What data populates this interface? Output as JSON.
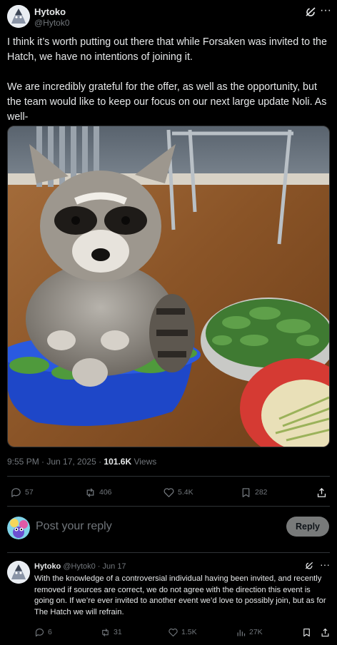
{
  "post": {
    "author_name": "Hytoko",
    "author_handle": "@Hytok0",
    "paragraphs": [
      "I think it’s worth putting out there that while Forsaken was invited to the Hatch, we have no intentions of joining it.",
      " We are incredibly grateful for the offer, as well as the opportunity, but the team would like to keep our focus on our next large update Noli. As well-"
    ],
    "image_icon": "raccoon-in-bowl-photo",
    "timestamp": "9:55 PM · Jun 17, 2025 · ",
    "views_count": "101.6K",
    "views_label": " Views",
    "replies": "57",
    "reposts": "406",
    "likes": "5.4K",
    "bookmarks": "282"
  },
  "reply_box": {
    "placeholder": "Post your reply",
    "button_label": "Reply"
  },
  "reply": {
    "author_name": "Hytoko",
    "author_handle": "@Hytok0",
    "date": " · Jun 17",
    "text": "With the knowledge of a controversial individual having been invited, and recently removed if sources are correct, we do not agree with the direction this event is going on. If we’re ever invited to another event we’d love to possibly join, but as for The Hatch we will refrain.",
    "replies": "6",
    "reposts": "31",
    "likes": "1.5K",
    "views": "27K"
  },
  "colors": {
    "background": "#000000",
    "text": "#e7e9ea",
    "muted": "#71767b",
    "divider": "#2f3336",
    "reply_button": "#787a7a"
  }
}
